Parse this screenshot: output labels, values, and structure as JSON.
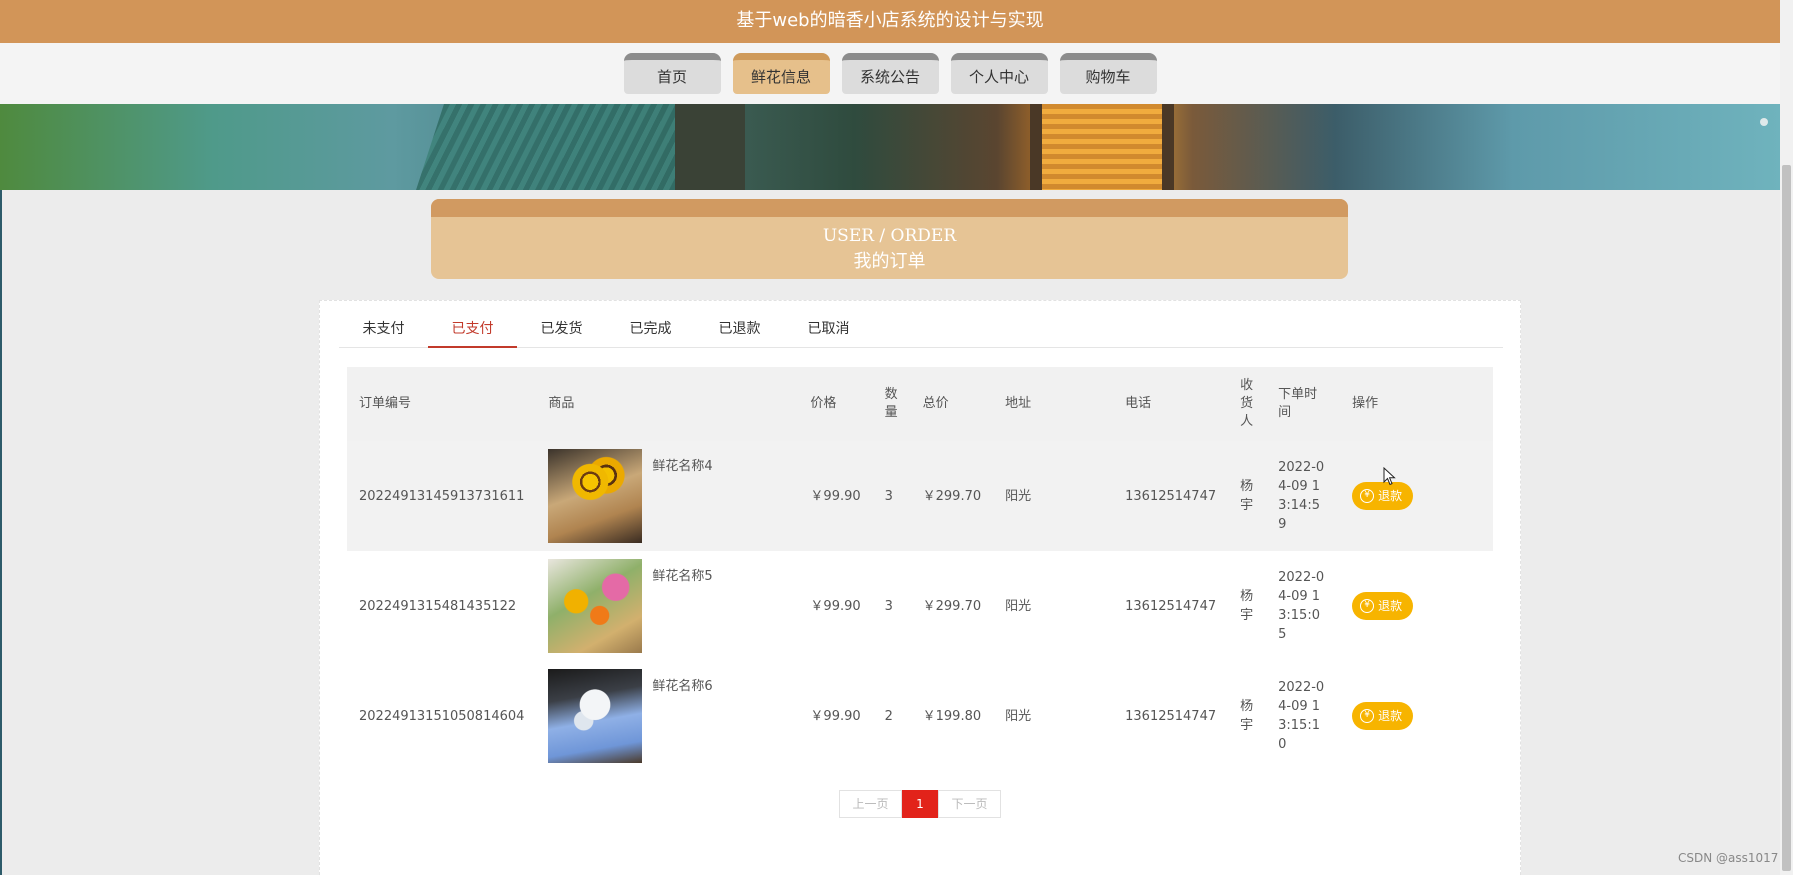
{
  "site": {
    "title": "基于web的暗香小店系统的设计与实现"
  },
  "nav": [
    {
      "label": "首页",
      "active": false
    },
    {
      "label": "鲜花信息",
      "active": true
    },
    {
      "label": "系统公告",
      "active": false
    },
    {
      "label": "个人中心",
      "active": false
    },
    {
      "label": "购物车",
      "active": false
    }
  ],
  "order_header": {
    "en": "USER / ORDER",
    "cn": "我的订单"
  },
  "tabs": [
    {
      "label": "未支付",
      "active": false
    },
    {
      "label": "已支付",
      "active": true
    },
    {
      "label": "已发货",
      "active": false
    },
    {
      "label": "已完成",
      "active": false
    },
    {
      "label": "已退款",
      "active": false
    },
    {
      "label": "已取消",
      "active": false
    }
  ],
  "table": {
    "headers": [
      "订单编号",
      "商品",
      "价格",
      "数量",
      "总价",
      "地址",
      "电话",
      "收货人",
      "下单时间",
      "操作"
    ],
    "rows": [
      {
        "order_id": "20224913145913731611",
        "product": "鲜花名称4",
        "price": "￥99.90",
        "qty": "3",
        "total": "￥299.70",
        "address": "阳光",
        "phone": "13612514747",
        "receiver": "杨宇",
        "time": "2022-04-09 13:14:59",
        "action": "退款"
      },
      {
        "order_id": "2022491315481435122",
        "product": "鲜花名称5",
        "price": "￥99.90",
        "qty": "3",
        "total": "￥299.70",
        "address": "阳光",
        "phone": "13612514747",
        "receiver": "杨宇",
        "time": "2022-04-09 13:15:05",
        "action": "退款"
      },
      {
        "order_id": "20224913151050814604",
        "product": "鲜花名称6",
        "price": "￥99.90",
        "qty": "2",
        "total": "￥199.80",
        "address": "阳光",
        "phone": "13612514747",
        "receiver": "杨宇",
        "time": "2022-04-09 13:15:10",
        "action": "退款"
      }
    ]
  },
  "pagination": {
    "prev": "上一页",
    "current": "1",
    "next": "下一页"
  },
  "icons": {
    "refund": "yen-circle-icon"
  },
  "colors": {
    "header": "#d29558",
    "active_nav": "#e6c08b",
    "active_tab": "#c23a2b",
    "refund_button": "#f7b400",
    "current_page": "#e2231a"
  },
  "watermark": "CSDN @ass1017"
}
